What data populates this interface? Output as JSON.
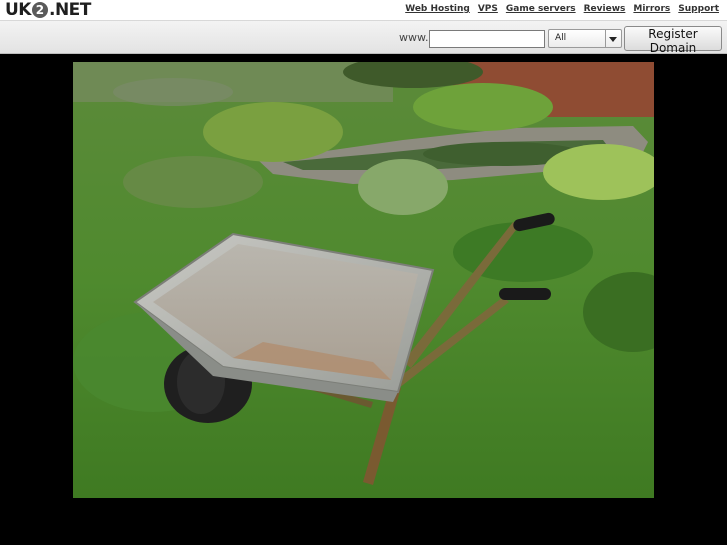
{
  "logo": {
    "part1": "UK",
    "badge": "2",
    "part2": ".NET"
  },
  "nav": {
    "items": [
      "Web Hosting",
      "VPS",
      "Game servers",
      "Reviews",
      "Mirrors",
      "Support"
    ]
  },
  "search": {
    "prefix": "www.",
    "value": "",
    "tld_selected": "All",
    "button_label": "Register Domain"
  },
  "photo": {
    "subject": "wheelbarrow-on-grass"
  }
}
